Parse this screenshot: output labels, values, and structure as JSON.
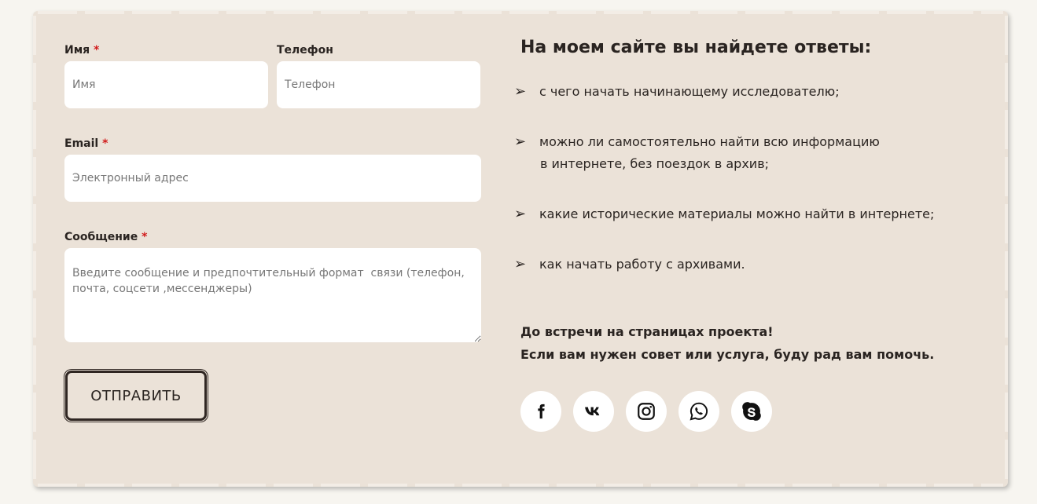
{
  "form": {
    "name_label": "Имя",
    "name_placeholder": "Имя",
    "phone_label": "Телефон",
    "phone_placeholder": "Телефон",
    "email_label": "Email",
    "email_placeholder": "Электронный адрес",
    "message_label": "Сообщение",
    "message_placeholder": "Введите сообщение и предпочтительный формат  связи (телефон, почта, соцсети ,мессенджеры)",
    "required_mark": "*",
    "submit_label": "ОТПРАВИТЬ"
  },
  "info": {
    "heading": "На моем сайте вы найдете ответы:",
    "bullet_symbol": "➢",
    "bullets": [
      {
        "line1": "с чего начать начинающему исследователю;",
        "line2": ""
      },
      {
        "line1": "можно ли самостоятельно найти всю информацию",
        "line2": "в интернете, без поездок в архив;"
      },
      {
        "line1": "какие исторические материалы можно найти в интернете;",
        "line2": ""
      },
      {
        "line1": "как начать работу с архивами.",
        "line2": ""
      }
    ],
    "closing_line1": "До встречи на страницах проекта!",
    "closing_line2": "Если вам нужен совет или услуга, буду рад вам помочь."
  },
  "social": {
    "icons": [
      "facebook-icon",
      "vk-icon",
      "instagram-icon",
      "whatsapp-icon",
      "skype-icon"
    ]
  },
  "colors": {
    "card_background": "#ebe2d8",
    "required": "#d11a1a",
    "text": "#2a2421"
  }
}
